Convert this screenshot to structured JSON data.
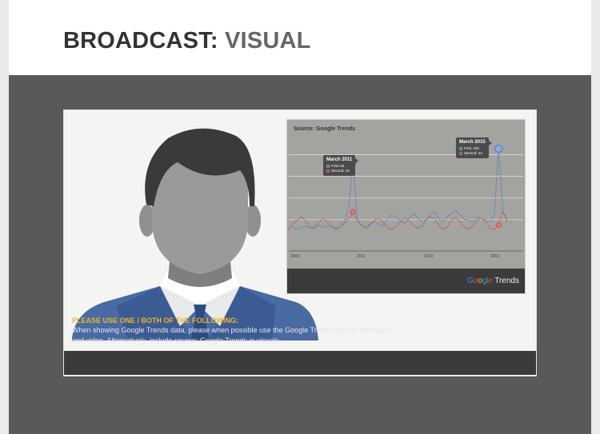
{
  "header": {
    "title_part1": "BROADCAST:",
    "title_part2": "VISUAL"
  },
  "chart": {
    "source_label": "Source: Google Trends",
    "logo": {
      "google": "Google",
      "trends": "Trends"
    },
    "callouts": [
      {
        "title": "March 2011",
        "first": "First: 84",
        "second": "Second: 24"
      },
      {
        "title": "March 2015",
        "first": "First: 100",
        "second": "Second: 24"
      }
    ],
    "colors": {
      "first": "#5b7fc4",
      "second": "#c9504d",
      "bg": "#a3a39f"
    }
  },
  "chart_data": {
    "type": "line",
    "title": "",
    "x_ticks": [
      "2009",
      "2011",
      "2013",
      "2015"
    ],
    "xlim": [
      "2009",
      "2016"
    ],
    "ylim": [
      0,
      100
    ],
    "grid": true,
    "series": [
      {
        "name": "First",
        "values": [
          4,
          6,
          3,
          5,
          7,
          4,
          6,
          8,
          5,
          7,
          6,
          4,
          9,
          12,
          30,
          84,
          15,
          8,
          6,
          10,
          12,
          9,
          7,
          15,
          20,
          18,
          14,
          10,
          16,
          22,
          18,
          12,
          14,
          20,
          24,
          16,
          12,
          18,
          22,
          26,
          20,
          15,
          14,
          12,
          18,
          16,
          14,
          12,
          20,
          100,
          25,
          12
        ]
      },
      {
        "name": "Second",
        "values": [
          3,
          10,
          14,
          18,
          12,
          6,
          4,
          12,
          16,
          12,
          7,
          3,
          5,
          10,
          16,
          24,
          14,
          8,
          4,
          8,
          14,
          16,
          12,
          5,
          3,
          6,
          12,
          17,
          14,
          8,
          4,
          6,
          14,
          18,
          16,
          8,
          3,
          6,
          14,
          17,
          12,
          6,
          3,
          7,
          14,
          16,
          12,
          4,
          3,
          8,
          24,
          14
        ]
      }
    ]
  },
  "notes": {
    "heading": "PLEASE USE ONE / BOTH OF THE FOLLOWING:",
    "line1": "When showing Google Trends data, please when possible use the Google Trends logo on all images",
    "line2": "and video. Alternatively, include source: Google Trends in visuals."
  }
}
